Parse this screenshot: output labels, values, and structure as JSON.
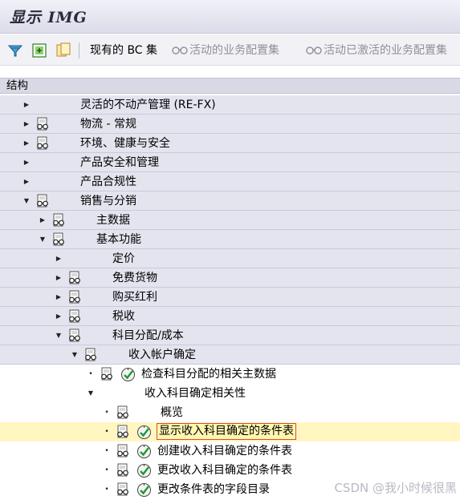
{
  "title": "显示 IMG",
  "toolbar": {
    "current_bc_set": "现有的 BC 集",
    "active_business_config_set": "活动的业务配置集",
    "active_activated_business_config_set": "活动已激活的业务配置集"
  },
  "structure_header": "结构",
  "tree": [
    {
      "label": "灵活的不动产管理 (RE-FX)",
      "level": 0,
      "toggle": "▸",
      "icon": "none"
    },
    {
      "label": "物流 - 常规",
      "level": 0,
      "toggle": "▸",
      "icon": "glasses-doc-icon"
    },
    {
      "label": "环境、健康与安全",
      "level": 0,
      "toggle": "▸",
      "icon": "glasses-doc-icon"
    },
    {
      "label": "产品安全和管理",
      "level": 0,
      "toggle": "▸",
      "icon": "none"
    },
    {
      "label": "产品合规性",
      "level": 0,
      "toggle": "▸",
      "icon": "none"
    },
    {
      "label": "销售与分销",
      "level": 0,
      "toggle": "▾",
      "icon": "glasses-doc-icon"
    },
    {
      "label": "主数据",
      "level": 1,
      "toggle": "▸",
      "icon": "glasses-doc-icon"
    },
    {
      "label": "基本功能",
      "level": 1,
      "toggle": "▾",
      "icon": "glasses-doc-icon"
    },
    {
      "label": "定价",
      "level": 2,
      "toggle": "▸",
      "icon": "none"
    },
    {
      "label": "免费货物",
      "level": 2,
      "toggle": "▸",
      "icon": "glasses-doc-icon"
    },
    {
      "label": "购买红利",
      "level": 2,
      "toggle": "▸",
      "icon": "glasses-doc-icon"
    },
    {
      "label": "税收",
      "level": 2,
      "toggle": "▸",
      "icon": "glasses-doc-icon"
    },
    {
      "label": "科目分配/成本",
      "level": 2,
      "toggle": "▾",
      "icon": "glasses-doc-icon"
    },
    {
      "label": "收入帐户确定",
      "level": 3,
      "toggle": "▾",
      "icon": "glasses-doc-icon"
    },
    {
      "label": "检查科目分配的相关主数据",
      "level": 4,
      "toggle": "•",
      "icon": "glasses-doc-icon",
      "exec": true
    },
    {
      "label": "收入科目确定相关性",
      "level": 4,
      "toggle": "▾",
      "icon": "none"
    },
    {
      "label": "概览",
      "level": 5,
      "toggle": "•",
      "icon": "glasses-doc-icon"
    },
    {
      "label": "显示收入科目确定的条件表",
      "level": 5,
      "toggle": "•",
      "icon": "glasses-doc-icon",
      "exec": true,
      "selected": true
    },
    {
      "label": "创建收入科目确定的条件表",
      "level": 5,
      "toggle": "•",
      "icon": "glasses-doc-icon",
      "exec": true
    },
    {
      "label": "更改收入科目确定的条件表",
      "level": 5,
      "toggle": "•",
      "icon": "glasses-doc-icon",
      "exec": true
    },
    {
      "label": "更改条件表的字段目录",
      "level": 5,
      "toggle": "•",
      "icon": "glasses-doc-icon",
      "exec": true
    }
  ],
  "watermark": "CSDN @我小时候很黑"
}
